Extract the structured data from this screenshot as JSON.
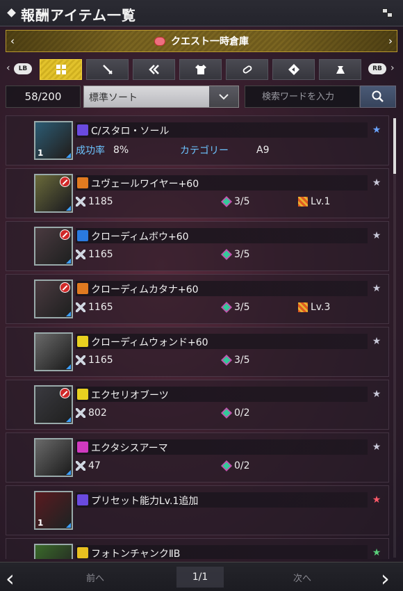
{
  "header": {
    "title": "報酬アイテム一覧"
  },
  "banner": {
    "label": "クエスト一時倉庫",
    "icon": "pig-icon"
  },
  "tabs": {
    "left_button": "LB",
    "right_button": "RB",
    "items": [
      {
        "name": "all",
        "icon": "grid-icon",
        "active": true
      },
      {
        "name": "weapon",
        "icon": "sword-icon"
      },
      {
        "name": "skill",
        "icon": "double-chevron-icon"
      },
      {
        "name": "armor",
        "icon": "shirt-icon"
      },
      {
        "name": "consumable",
        "icon": "capsule-icon"
      },
      {
        "name": "material",
        "icon": "diamond-arrow-icon"
      },
      {
        "name": "other",
        "icon": "pouch-icon"
      }
    ]
  },
  "controls": {
    "count": "58/200",
    "sort_value": "標準ソート",
    "search_placeholder": "検索ワードを入力"
  },
  "items": [
    {
      "name": "C/スタロ・ソール",
      "type_color": "#6a4adf",
      "thumb_color": "#2c5c74",
      "qty": "1",
      "ban": false,
      "rarity": "9",
      "stats": [
        {
          "label": "成功率",
          "value": "8%"
        },
        {
          "label": "カテゴリー",
          "value": "A9"
        }
      ]
    },
    {
      "name": "ユヴェールワイヤー+60",
      "type_color": "#e07a20",
      "thumb_color": "#6a6a3a",
      "qty": "",
      "ban": true,
      "rarity": "13",
      "stats": [
        {
          "value": "1185"
        },
        {
          "value": "3/5"
        },
        {
          "value": "Lv.1"
        }
      ]
    },
    {
      "name": "クローディムボウ+60",
      "type_color": "#2a7ae0",
      "thumb_color": "#4a3a40",
      "qty": "",
      "ban": true,
      "rarity": "12",
      "stats": [
        {
          "value": "1165"
        },
        {
          "value": "3/5"
        }
      ]
    },
    {
      "name": "クローディムカタナ+60",
      "type_color": "#e07a20",
      "thumb_color": "#4a3a40",
      "qty": "",
      "ban": true,
      "rarity": "12",
      "stats": [
        {
          "value": "1165"
        },
        {
          "value": "3/5"
        },
        {
          "value": "Lv.3"
        }
      ]
    },
    {
      "name": "クローディムウォンド+60",
      "type_color": "#e8d020",
      "thumb_color": "#6a6a6a",
      "qty": "",
      "ban": false,
      "rarity": "12",
      "stats": [
        {
          "value": "1165"
        },
        {
          "value": "3/5"
        }
      ]
    },
    {
      "name": "エクセリオブーツ",
      "type_color": "#e8d020",
      "thumb_color": "#3a3a40",
      "qty": "",
      "ban": true,
      "rarity": "11",
      "stats": [
        {
          "value": "802"
        },
        {
          "value": "0/2"
        }
      ]
    },
    {
      "name": "エクタシスアーマ",
      "type_color": "#d03ac0",
      "thumb_color": "#6a6a6a",
      "qty": "",
      "ban": false,
      "rarity": "10",
      "stats": [
        {
          "value": "47"
        },
        {
          "value": "0/2"
        }
      ]
    },
    {
      "name": "プリセット能力Lv.1追加",
      "type_color": "#6a4adf",
      "thumb_color": "#5a1a20",
      "qty": "1",
      "ban": false,
      "rarity": "8",
      "stats": []
    },
    {
      "name": "フォトンチャンクⅡB",
      "type_color": "#e8c020",
      "thumb_color": "#3a6a2a",
      "qty": "",
      "ban": false,
      "rarity": "5",
      "stats": []
    }
  ],
  "footer": {
    "prev_label": "前へ",
    "next_label": "次へ",
    "page": "1/1"
  }
}
